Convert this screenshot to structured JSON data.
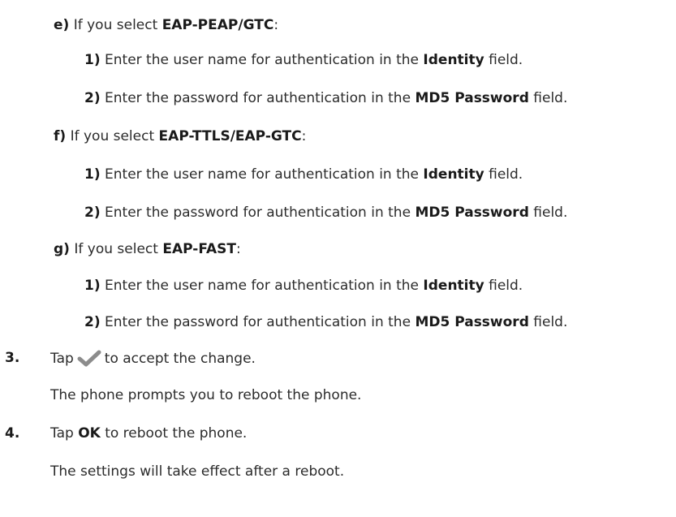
{
  "items": [
    {
      "label": "e)",
      "pre": " If you select ",
      "bold": "EAP-PEAP/GTC",
      "post": ":"
    },
    {
      "label": "1)",
      "pre": " Enter the user name for authentication in the ",
      "bold": "Identity",
      "post": " field."
    },
    {
      "label": "2)",
      "pre": " Enter the password for authentication in the ",
      "bold": "MD5 Password",
      "post": " field."
    },
    {
      "label": "f)",
      "pre": " If you select ",
      "bold": "EAP-TTLS/EAP-GTC",
      "post": ":"
    },
    {
      "label": "1)",
      "pre": " Enter the user name for authentication in the ",
      "bold": "Identity",
      "post": " field."
    },
    {
      "label": "2)",
      "pre": " Enter the password for authentication in the ",
      "bold": "MD5 Password",
      "post": " field."
    },
    {
      "label": "g)",
      "pre": " If you select ",
      "bold": "EAP-FAST",
      "post": ":"
    },
    {
      "label": "1)",
      "pre": " Enter the user name for authentication in the ",
      "bold": "Identity",
      "post": " field."
    },
    {
      "label": "2)",
      "pre": " Enter the password for authentication in the ",
      "bold": "MD5 Password",
      "post": " field."
    }
  ],
  "step3": {
    "num": "3.",
    "pre": "Tap",
    "post": "to accept the change.",
    "note": "The phone prompts you to reboot the phone."
  },
  "step4": {
    "num": "4.",
    "pre": "Tap ",
    "bold": "OK",
    "post": " to reboot the phone.",
    "note": "The settings will take effect after a reboot."
  },
  "colors": {
    "text": "#2b2b2b",
    "check": "#8c8c8c"
  },
  "icons": {
    "accept": "check-icon"
  }
}
